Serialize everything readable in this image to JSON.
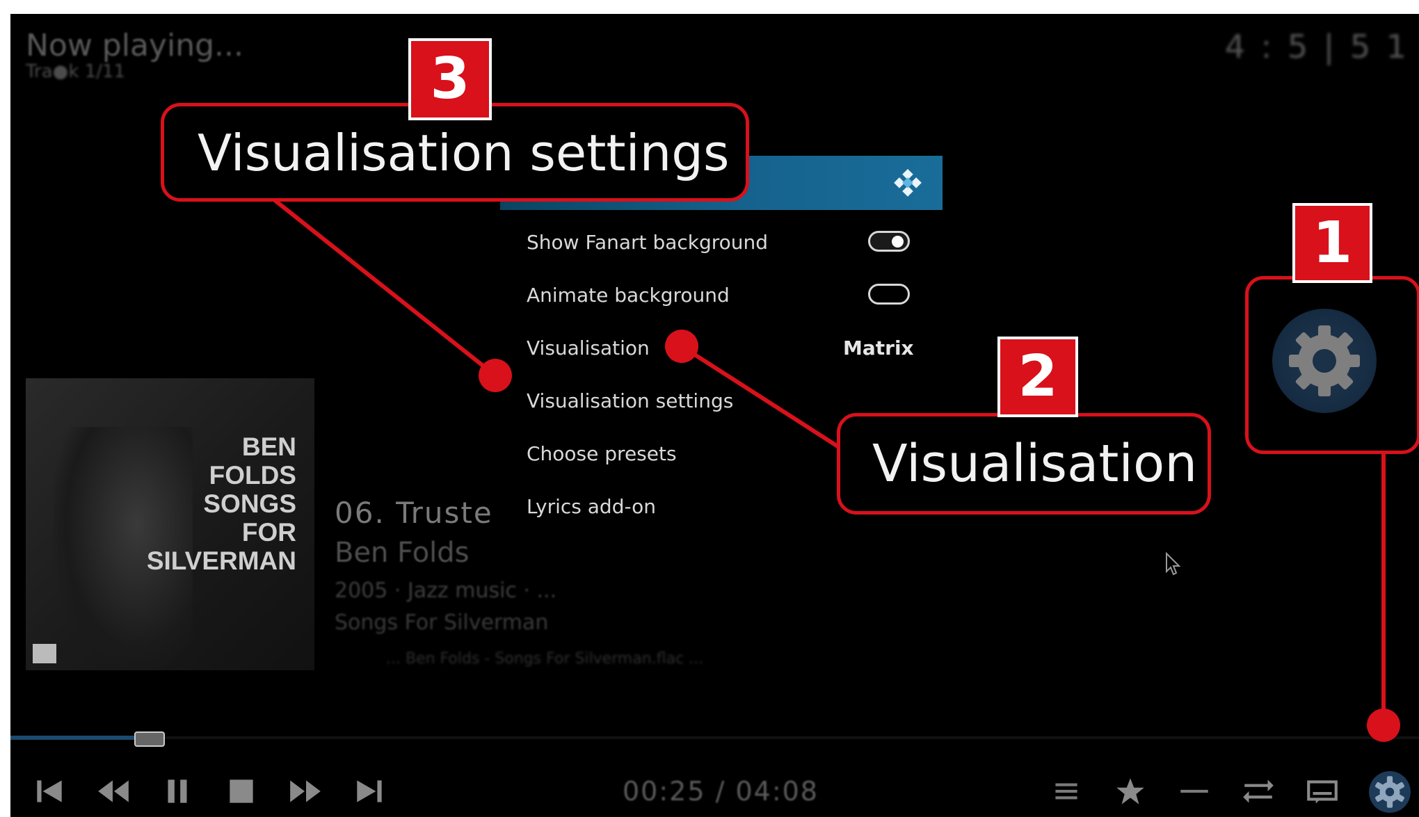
{
  "header": {
    "title": "Now playing...",
    "subtitle": "Tra●k 1/11",
    "clock": "4 : 5 | 5 1"
  },
  "settings_menu": {
    "options": [
      {
        "label": "Show Fanart background",
        "control": "toggle",
        "on": true
      },
      {
        "label": "Animate background",
        "control": "toggle",
        "on": false
      },
      {
        "label": "Visualisation",
        "value": "Matrix"
      },
      {
        "label": "Visualisation settings"
      },
      {
        "label": "Choose presets"
      },
      {
        "label": "Lyrics add-on"
      }
    ]
  },
  "album_cover": {
    "text": "BEN\nFOLDS\nSONGS\nFOR\nSILVERMAN"
  },
  "now_playing": {
    "track": "06. Truste",
    "artist": "Ben Folds",
    "meta": "2005 · Jazz music · ...",
    "album": "Songs For Silverman",
    "path": "... Ben Folds - Songs For Silverman.flac ..."
  },
  "playback": {
    "time": "00:25 / 04:08",
    "progress": 0.1
  },
  "controls": {
    "left": [
      "skip-previous-icon",
      "rewind-icon",
      "pause-icon",
      "stop-icon",
      "fast-forward-icon",
      "skip-next-icon"
    ],
    "right": [
      "playlist-icon",
      "star-icon",
      "repeat-icon",
      "shuffle-icon",
      "subtitles-icon",
      "settings-gear-icon"
    ]
  },
  "annotations": {
    "callout_1": {
      "number": "1"
    },
    "callout_2": {
      "number": "2",
      "label": "Visualisation"
    },
    "callout_3": {
      "number": "3",
      "label": "Visualisation settings"
    },
    "accent_color": "#d8111b"
  },
  "colors": {
    "background": "#000000",
    "dialog_header": "#15628d",
    "progress": "#1c4a70"
  }
}
